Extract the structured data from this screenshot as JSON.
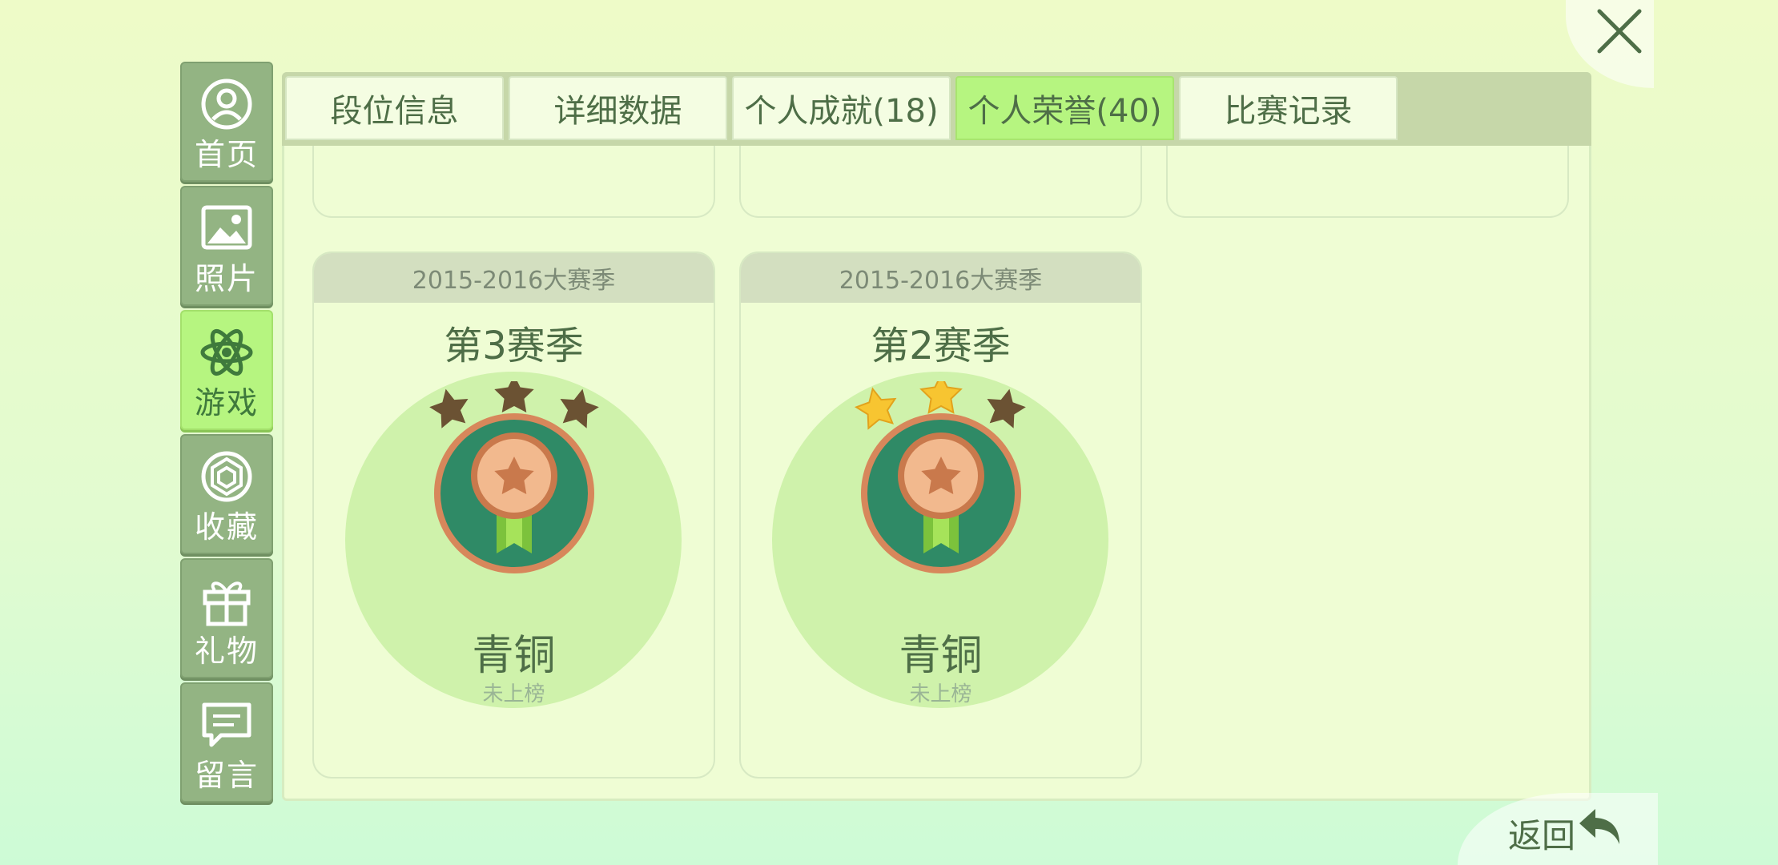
{
  "sidebar": {
    "items": [
      {
        "label": "首页",
        "icon": "profile-icon"
      },
      {
        "label": "照片",
        "icon": "image-icon"
      },
      {
        "label": "游戏",
        "icon": "atom-icon"
      },
      {
        "label": "收藏",
        "icon": "collection-icon"
      },
      {
        "label": "礼物",
        "icon": "gift-icon"
      },
      {
        "label": "留言",
        "icon": "message-icon"
      }
    ],
    "active_index": 2
  },
  "tabs": [
    {
      "label": "段位信息"
    },
    {
      "label": "详细数据"
    },
    {
      "label": "个人成就(18)"
    },
    {
      "label": "个人荣誉(40)"
    },
    {
      "label": "比赛记录"
    }
  ],
  "active_tab_index": 3,
  "cards": [
    {
      "season_range": "2015-2016大赛季",
      "season": "第3赛季",
      "rank": "青铜",
      "status": "未上榜",
      "stars_lit": 0,
      "stars_total": 3
    },
    {
      "season_range": "2015-2016大赛季",
      "season": "第2赛季",
      "rank": "青铜",
      "status": "未上榜",
      "stars_lit": 2,
      "stars_total": 3
    }
  ],
  "back_label": "返回",
  "colors": {
    "accent": "#b6f580",
    "sidebar_bg": "#93b483",
    "panel_bg": "#effdd4",
    "star_lit": "#f7c531",
    "star_dim": "#6b5233",
    "medal_green": "#2f8a66",
    "medal_bronze": "#d7875b"
  }
}
